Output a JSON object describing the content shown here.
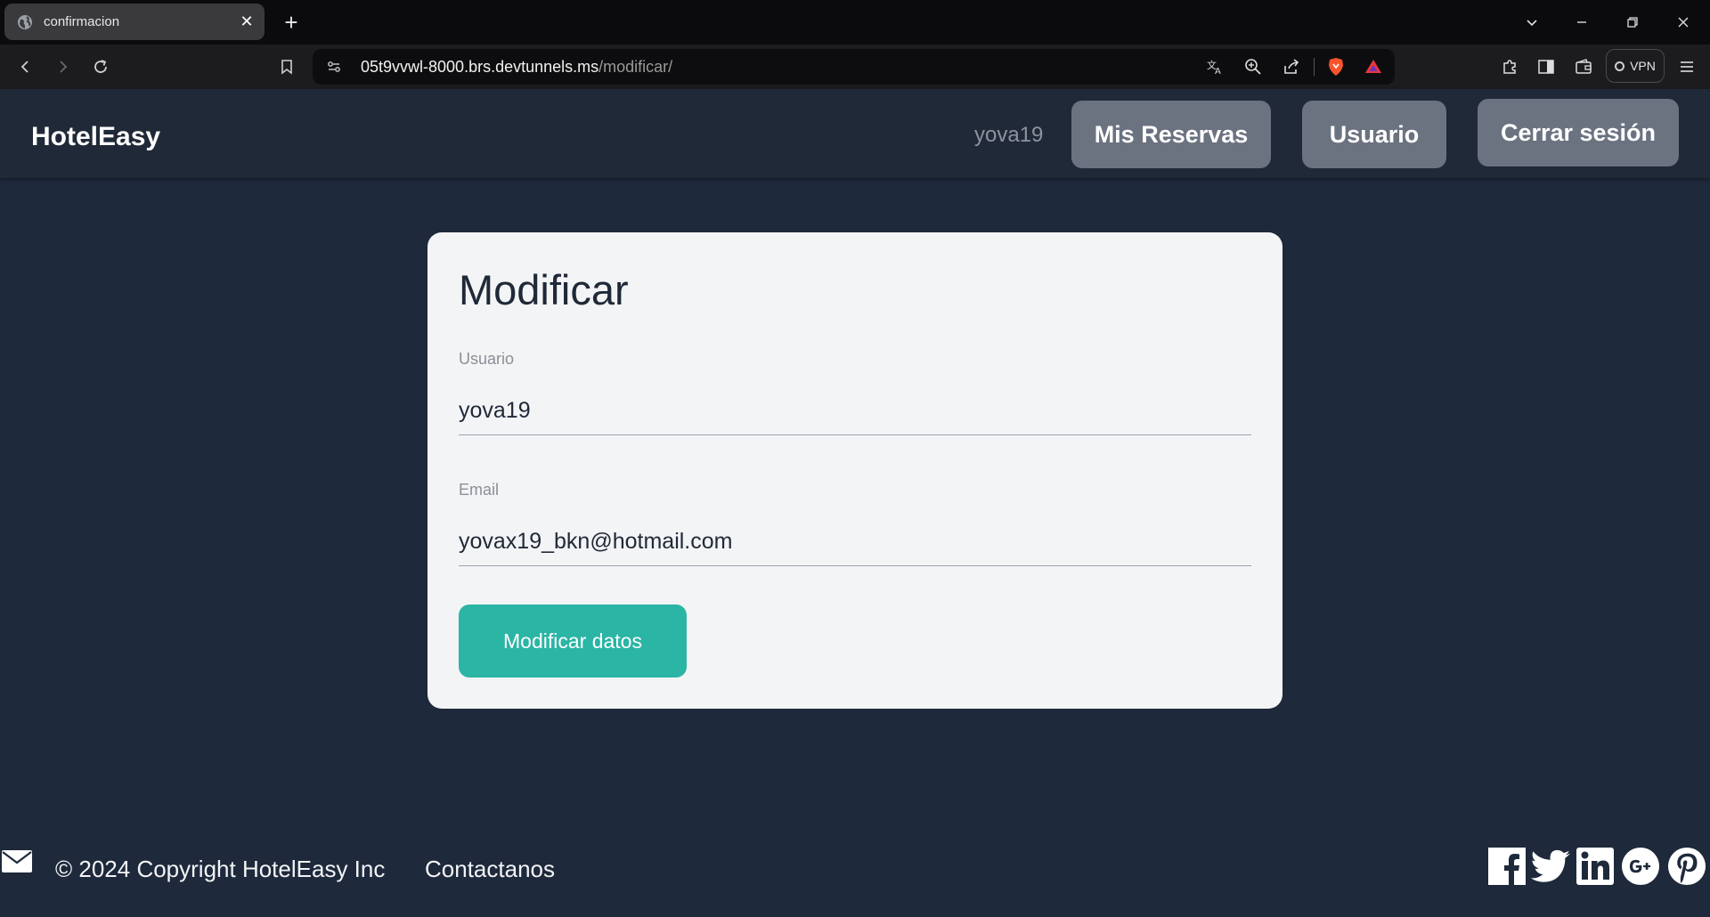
{
  "browser": {
    "tab_title": "confirmacion",
    "url_host": "05t9vvwl-8000.brs.devtunnels.ms",
    "url_path": "/modificar/",
    "vpn_label": "VPN"
  },
  "header": {
    "brand": "HotelEasy",
    "username": "yova19",
    "buttons": {
      "reservations": "Mis Reservas",
      "user": "Usuario",
      "logout": "Cerrar sesión"
    }
  },
  "form": {
    "title": "Modificar",
    "username_label": "Usuario",
    "username_value": "yova19",
    "email_label": "Email",
    "email_value": "yovax19_bkn@hotmail.com",
    "submit_label": "Modificar datos"
  },
  "footer": {
    "copyright": "© 2024 Copyright HotelEasy Inc",
    "contact": "Contactanos",
    "social_icons": [
      "facebook-icon",
      "twitter-icon",
      "linkedin-icon",
      "google-plus-icon",
      "pinterest-icon"
    ]
  },
  "colors": {
    "page_bg": "#1e293b",
    "header_bg": "#1f2937",
    "header_button": "#6b7280",
    "card_bg": "#f3f4f6",
    "accent": "#2bb5a5"
  }
}
